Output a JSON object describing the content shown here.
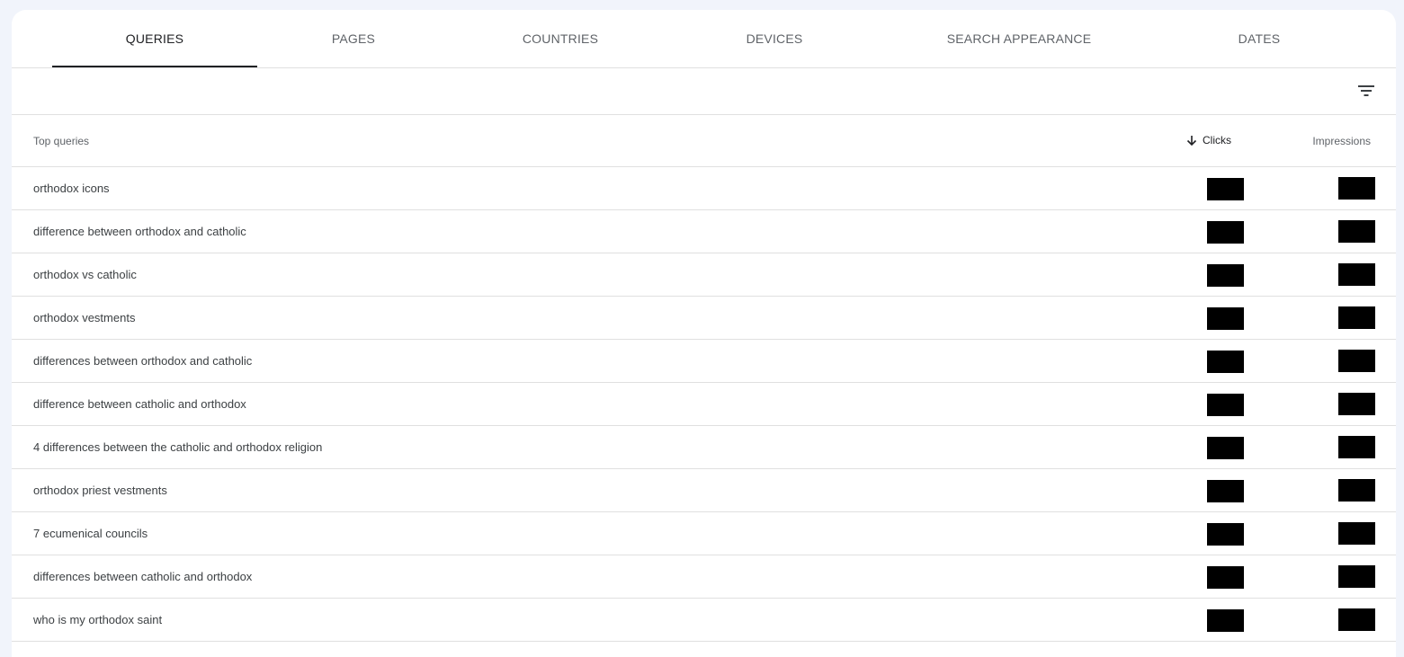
{
  "tabs": [
    {
      "label": "QUERIES",
      "active": true
    },
    {
      "label": "PAGES",
      "active": false
    },
    {
      "label": "COUNTRIES",
      "active": false
    },
    {
      "label": "DEVICES",
      "active": false
    },
    {
      "label": "SEARCH APPEARANCE",
      "active": false
    },
    {
      "label": "DATES",
      "active": false
    }
  ],
  "toolbar": {
    "filter_icon": "filter-list-icon"
  },
  "table": {
    "headers": {
      "query": "Top queries",
      "clicks": "Clicks",
      "impressions": "Impressions",
      "sort_icon": "arrow-down-icon"
    },
    "rows": [
      {
        "query": "orthodox icons"
      },
      {
        "query": "difference between orthodox and catholic"
      },
      {
        "query": "orthodox vs catholic"
      },
      {
        "query": "orthodox vestments"
      },
      {
        "query": "differences between orthodox and catholic"
      },
      {
        "query": "difference between catholic and orthodox"
      },
      {
        "query": "4 differences between the catholic and orthodox religion"
      },
      {
        "query": "orthodox priest vestments"
      },
      {
        "query": "7 ecumenical councils"
      },
      {
        "query": "differences between catholic and orthodox"
      },
      {
        "query": "who is my orthodox saint"
      }
    ],
    "redaction_color": "#000000"
  },
  "colors": {
    "page_background": "#f1f4fb",
    "card_background": "#ffffff",
    "divider": "#e0e0e0",
    "active_tab": "#202124",
    "inactive_tab": "#5f6368"
  }
}
